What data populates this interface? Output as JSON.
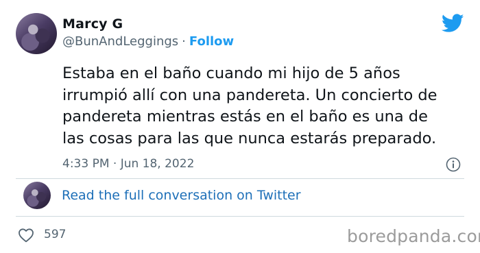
{
  "tweet": {
    "author_name": "Marcy G",
    "handle": "@BunAndLeggings",
    "separator": "·",
    "follow_label": "Follow",
    "text_lines": [
      "Estaba en el baño cuando mi hijo de 5 años",
      "irrumpió allí con una pandereta. Un concierto de",
      "pandereta mientras estás en el baño es una de",
      "las cosas para las que nunca estarás preparado."
    ],
    "timestamp": "4:33 PM · Jun 18, 2022",
    "read_conversation_label": "Read the full conversation on Twitter",
    "like_count": "597"
  },
  "icons": {
    "brand": "twitter-bird-icon",
    "info": "info-icon",
    "like": "heart-icon"
  },
  "colors": {
    "accent": "#1d9bf0",
    "secondary_text": "#536471",
    "link": "#1d6fb8",
    "divider": "#cfd9de",
    "watermark": "#9b9b9b"
  },
  "watermark": "boredpanda.com"
}
